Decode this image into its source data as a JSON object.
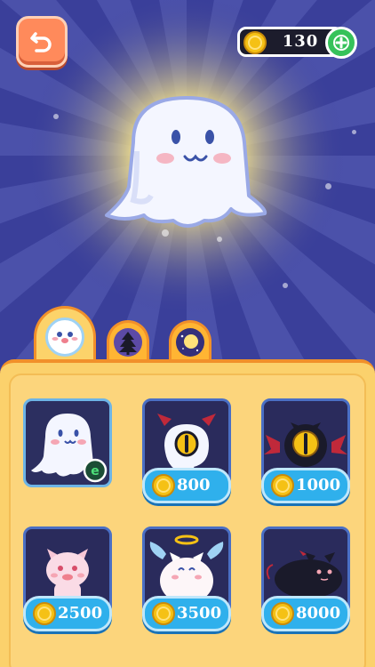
{
  "top_bar": {
    "back_icon": "back-arrow-icon",
    "coins": "130",
    "add_icon": "plus-icon"
  },
  "colors": {
    "background": "#3a3f9a",
    "panel": "#fbd16c",
    "accent_orange": "#ff8a5b",
    "price_blue": "#2fb0ec",
    "card_navy": "#2a2b5c",
    "coin_gold": "#f5c115"
  },
  "tabs": [
    {
      "icon": "ghost-face-icon",
      "selected": true
    },
    {
      "icon": "pine-tree-icon",
      "selected": false
    },
    {
      "icon": "moon-icon",
      "selected": false
    }
  ],
  "skins": [
    {
      "character": "ghost",
      "owned": true,
      "badge": "e"
    },
    {
      "character": "cyclops-ghost",
      "price": "800"
    },
    {
      "character": "bat-eye",
      "price": "1000"
    },
    {
      "character": "pink-cat",
      "price": "2500"
    },
    {
      "character": "angel-cat",
      "price": "3500"
    },
    {
      "character": "black-cat",
      "price": "8000"
    }
  ]
}
